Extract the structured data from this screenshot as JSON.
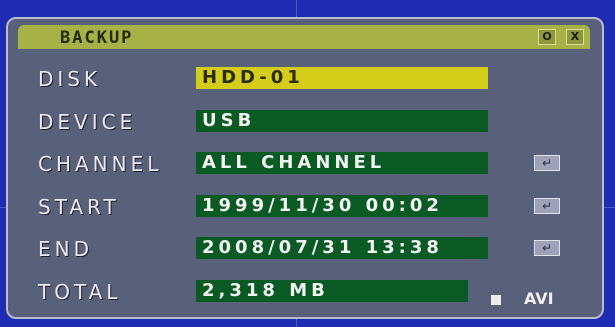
{
  "window": {
    "title": "BACKUP",
    "buttons": {
      "ok_label": "O",
      "close_label": "X"
    }
  },
  "rows": {
    "disk": {
      "label": "DISK",
      "value": "HDD-01"
    },
    "device": {
      "label": "DEVICE",
      "value": "USB"
    },
    "channel": {
      "label": "CHANNEL",
      "value": "ALL CHANNEL"
    },
    "start": {
      "label": "START",
      "value": "1999/11/30 00:02"
    },
    "end": {
      "label": "END",
      "value": "2008/07/31 13:38"
    },
    "total": {
      "label": "TOTAL",
      "value": "2,318 MB"
    }
  },
  "format": {
    "checkbox_checked": true,
    "label": "AVI"
  },
  "icons": {
    "enter": "enter-icon"
  },
  "colors": {
    "screen_bg": "#1d2cb0",
    "panel_bg": "#59607a",
    "title_bar": "#a6b245",
    "field_bg": "#0a5a24",
    "selected_field": "#d4ce1a"
  }
}
